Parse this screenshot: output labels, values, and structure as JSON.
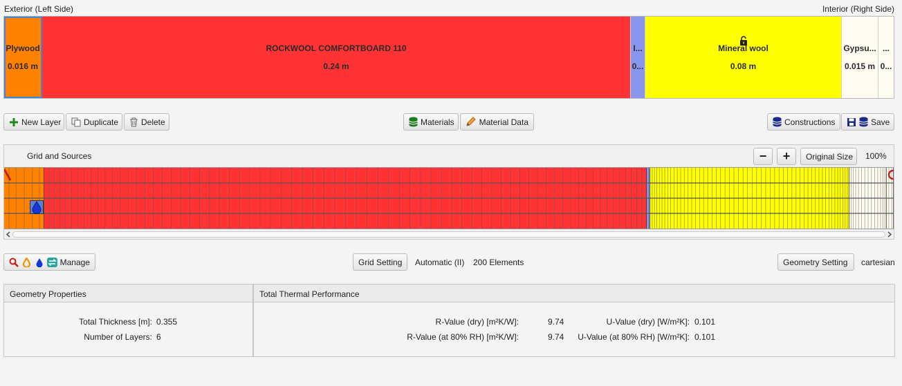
{
  "header": {
    "left_label": "Exterior (Left Side)",
    "right_label": "Interior (Right Side)"
  },
  "layers": [
    {
      "name": "Plywood",
      "thickness": "0.016 m",
      "color": "#ff8200",
      "selected": true
    },
    {
      "name": "ROCKWOOL COMFORTBOARD 110",
      "thickness": "0.24 m",
      "color": "#ff3333"
    },
    {
      "name": "I...",
      "thickness": "0...",
      "color": "#8a96ee"
    },
    {
      "name": "Mineral wool",
      "thickness": "0.08 m",
      "color": "#ffff00",
      "locked": true,
      "lock_icon": "unlock-icon"
    },
    {
      "name": "Gypsu...",
      "thickness": "0.015 m",
      "color": "#fffdf2"
    },
    {
      "name": "...",
      "thickness": "0...",
      "color": "#fffdf2"
    }
  ],
  "toolbar": {
    "new_layer": "New Layer",
    "duplicate": "Duplicate",
    "delete": "Delete",
    "materials": "Materials",
    "material_data": "Material Data",
    "constructions": "Constructions",
    "save": "Save"
  },
  "grid": {
    "title": "Grid and Sources",
    "zoom_out": "−",
    "zoom_in": "+",
    "original_size": "Original Size",
    "zoom_pct": "100%"
  },
  "sources": {
    "manage": "Manage",
    "grid_setting": "Grid Setting",
    "grid_mode": "Automatic (II)",
    "elements": "200 Elements",
    "geometry_setting": "Geometry Setting",
    "geometry_type": "cartesian"
  },
  "geometry": {
    "title": "Geometry Properties",
    "thickness_label": "Total Thickness [m]:",
    "thickness_value": "0.355",
    "layers_label": "Number of Layers:",
    "layers_value": "6"
  },
  "thermal": {
    "title": "Total Thermal Performance",
    "r_dry_label": "R-Value (dry) [m²K/W]:",
    "r_dry_value": "9.74",
    "r_80_label": "R-Value (at 80% RH) [m²K/W]:",
    "r_80_value": "9.74",
    "u_dry_label": "U-Value (dry) [W/m²K]:",
    "u_dry_value": "0.101",
    "u_80_label": "U-Value (at 80% RH) [W/m²K]:",
    "u_80_value": "0.101"
  }
}
